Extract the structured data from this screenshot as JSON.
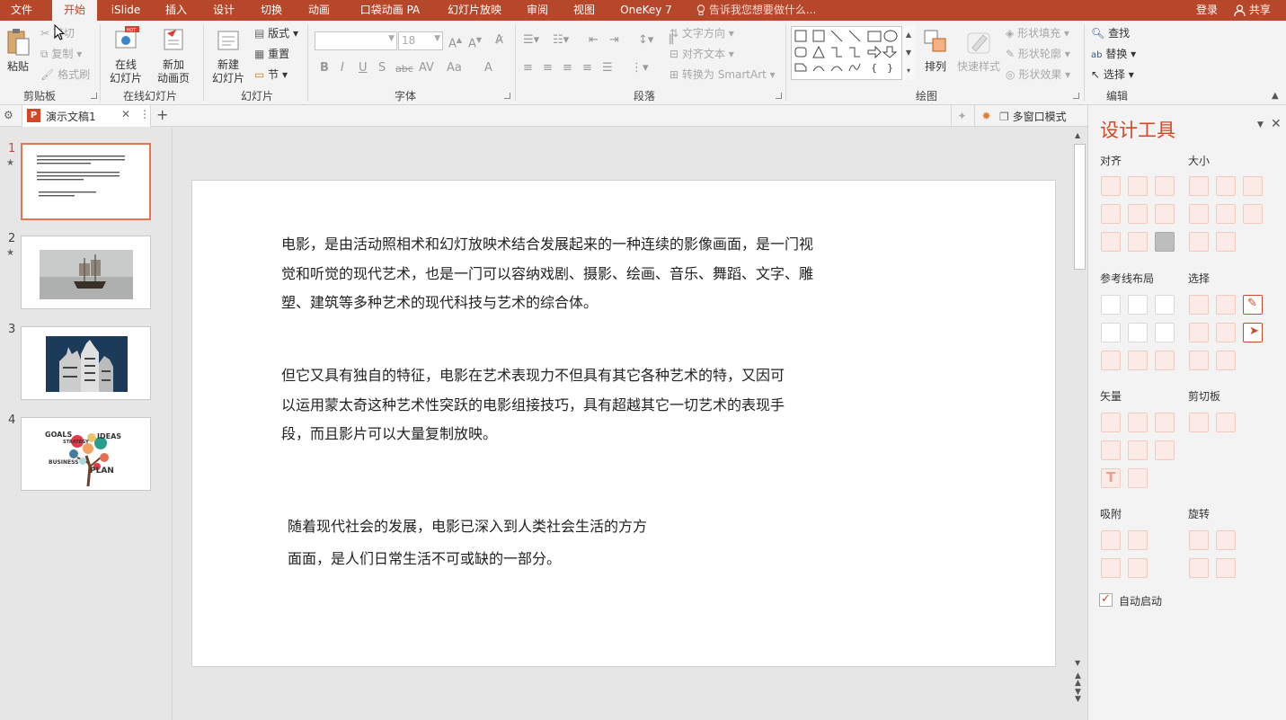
{
  "menu": {
    "tabs": [
      "文件",
      "开始",
      "iSlide",
      "插入",
      "设计",
      "切换",
      "动画",
      "口袋动画 PA",
      "幻灯片放映",
      "审阅",
      "视图",
      "OneKey 7"
    ],
    "active": "开始",
    "tell_me": "告诉我您想要做什么...",
    "login": "登录",
    "share": "共享"
  },
  "ribbon": {
    "clipboard": {
      "paste": "粘贴",
      "cut": "剪切",
      "copy": "复制",
      "format_painter": "格式刷",
      "label": "剪贴板"
    },
    "online_slides": {
      "online": "在线\n幻灯片",
      "new_anim": "新加\n动画页",
      "label": "在线幻灯片"
    },
    "slides": {
      "new_slide": "新建\n幻灯片",
      "layout": "版式",
      "reset": "重置",
      "section": "节",
      "label": "幻灯片"
    },
    "font": {
      "size": "18",
      "label": "字体",
      "buttons": [
        "B",
        "I",
        "U",
        "S",
        "abc",
        "AV",
        "Aa",
        "A"
      ]
    },
    "paragraph": {
      "text_direction": "文字方向",
      "align_text": "对齐文本",
      "smartart": "转换为 SmartArt",
      "label": "段落"
    },
    "drawing": {
      "arrange": "排列",
      "quick_styles": "快速样式",
      "shape_fill": "形状填充",
      "shape_outline": "形状轮廓",
      "shape_effects": "形状效果",
      "label": "绘图"
    },
    "editing": {
      "find": "查找",
      "replace": "替换",
      "select": "选择",
      "label": "编辑"
    }
  },
  "doc_tab": {
    "title": "演示文稿1",
    "multi_window": "多窗口模式"
  },
  "thumbnails": [
    {
      "num": "1",
      "star": "★",
      "selected": true
    },
    {
      "num": "2",
      "star": "★",
      "selected": false
    },
    {
      "num": "3",
      "star": "",
      "selected": false
    },
    {
      "num": "4",
      "star": "",
      "selected": false
    }
  ],
  "thumb4_words": {
    "goals": "GOALS",
    "ideas": "IDEAS",
    "strategy": "STRATEGY",
    "business": "BUSINESS",
    "plan": "PLAN"
  },
  "slide": {
    "p1": [
      "电影，是由活动照相术和幻灯放映术结合发展起来的一种连续的影像画面，是一门视",
      "觉和听觉的现代艺术，也是一门可以容纳戏剧、摄影、绘画、音乐、舞蹈、文字、雕",
      "塑、建筑等多种艺术的现代科技与艺术的综合体。"
    ],
    "p2": [
      "但它又具有独自的特征，电影在艺术表现力不但具有其它各种艺术的特，又因可",
      "以运用蒙太奇这种艺术性突跃的电影组接技巧，具有超越其它一切艺术的表现手",
      "段，而且影片可以大量复制放映。"
    ],
    "p3": [
      "随着现代社会的发展，电影已深入到人类社会生活的方方",
      "面面，是人们日常生活不可或缺的一部分。"
    ]
  },
  "panel": {
    "title": "设计工具",
    "sections": {
      "align": "对齐",
      "size": "大小",
      "guides": "参考线布局",
      "select": "选择",
      "vector": "矢量",
      "clipboard": "剪切板",
      "snap": "吸附",
      "rotate": "旋转"
    },
    "auto_start": "自动启动"
  },
  "colors": {
    "accent": "#b7472a",
    "title_red": "#d24726"
  }
}
